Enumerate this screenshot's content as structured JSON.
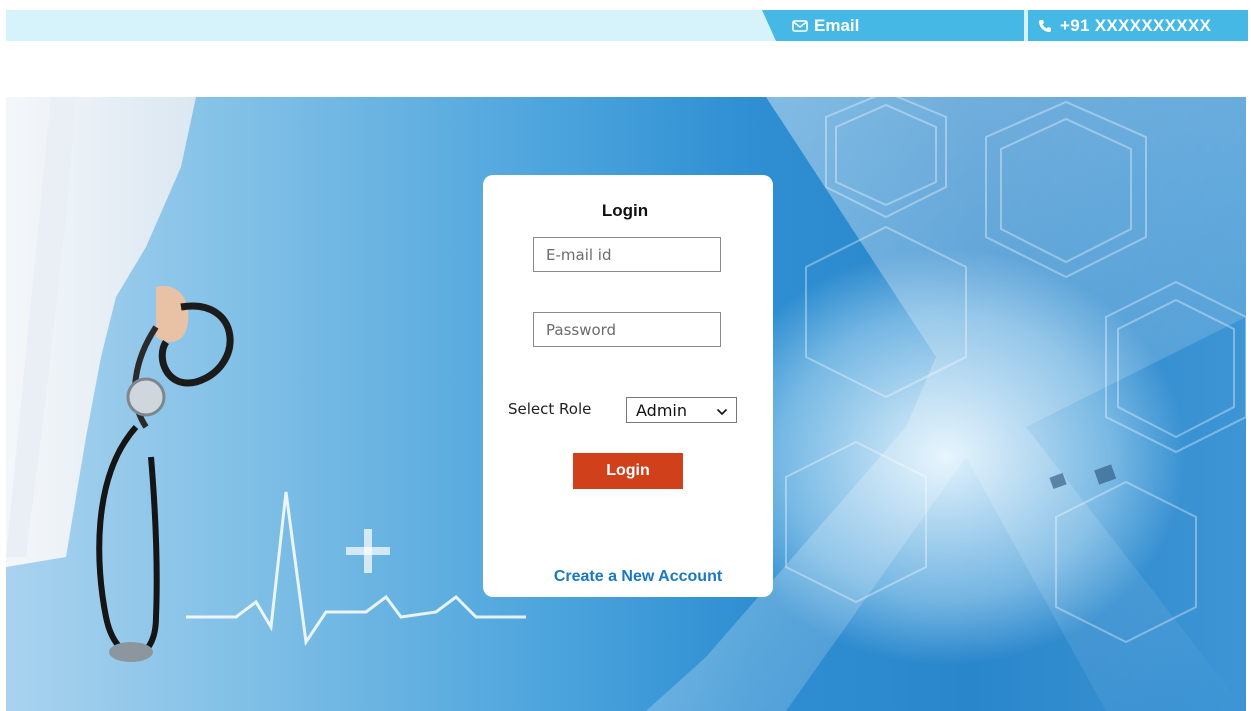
{
  "topbar": {
    "email_label": "Email",
    "phone_label": "+91 XXXXXXXXXX",
    "email_icon": "envelope-icon",
    "phone_icon": "phone-icon",
    "accent_color": "#46b8e5",
    "bar_color": "#d6f2fb"
  },
  "login": {
    "title": "Login",
    "email_placeholder": "E-mail id",
    "password_placeholder": "Password",
    "role_label": "Select Role",
    "role_selected": "Admin",
    "submit_label": "Login",
    "create_account_label": "Create a New Account",
    "button_color": "#d0401a",
    "link_color": "#1a78c2"
  }
}
